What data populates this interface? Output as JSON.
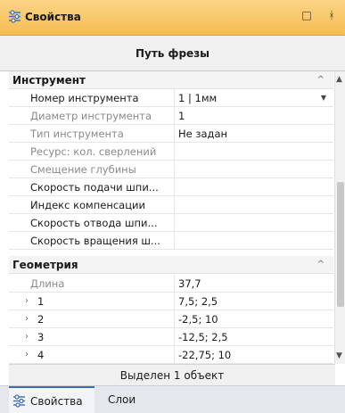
{
  "panel": {
    "title": "Свойства",
    "maximize_glyph": "□",
    "pin_glyph": "ᚼ",
    "header": "Путь фрезы",
    "title_icon": "properties-icon"
  },
  "categories": {
    "tool": {
      "label": "Инструмент",
      "rows": [
        {
          "name": "Номер инструмента",
          "value": "1 | 1мм",
          "enabled": true,
          "dropdown": true
        },
        {
          "name": "Диаметр инструмента",
          "value": "1",
          "enabled": false
        },
        {
          "name": "Тип инструмента",
          "value": "Не задан",
          "enabled": false
        },
        {
          "name": "Ресурс: кол. сверлений",
          "value": "",
          "enabled": false
        },
        {
          "name": "Смещение глубины",
          "value": "",
          "enabled": false
        },
        {
          "name": "Скорость подачи шпи...",
          "value": "",
          "enabled": true
        },
        {
          "name": "Индекс компенсации",
          "value": "",
          "enabled": true
        },
        {
          "name": "Скорость отвода шпи...",
          "value": "",
          "enabled": true
        },
        {
          "name": "Скорость вращения ш...",
          "value": "",
          "enabled": true
        }
      ]
    },
    "geometry": {
      "label": "Геометрия",
      "rows": [
        {
          "name": "Длина",
          "value": "37,7",
          "enabled": false
        },
        {
          "name": "1",
          "value": "7,5; 2,5",
          "enabled": true
        },
        {
          "name": "2",
          "value": "-2,5; 10",
          "enabled": true
        },
        {
          "name": "3",
          "value": "-12,5; 2,5",
          "enabled": true
        },
        {
          "name": "4",
          "value": "-22,75; 10",
          "enabled": true
        }
      ]
    }
  },
  "status": "Выделен 1 объект",
  "tabs": [
    {
      "label": "Свойства",
      "active": true,
      "icon": "properties-icon"
    },
    {
      "label": "Слои",
      "active": false
    }
  ]
}
